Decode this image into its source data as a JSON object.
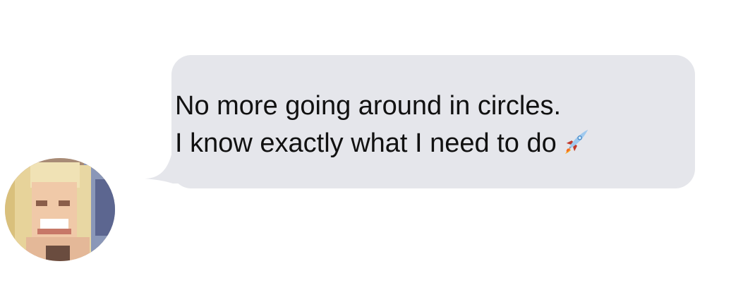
{
  "message": {
    "lines": [
      "No more going around in circles.",
      "I know exactly what I need to do"
    ],
    "emoji_icon": "rocket-icon"
  },
  "colors": {
    "bubble": "#e5e6eb",
    "text": "#111111",
    "background": "#ffffff"
  },
  "avatar": {
    "icon": "user-avatar-photo"
  }
}
